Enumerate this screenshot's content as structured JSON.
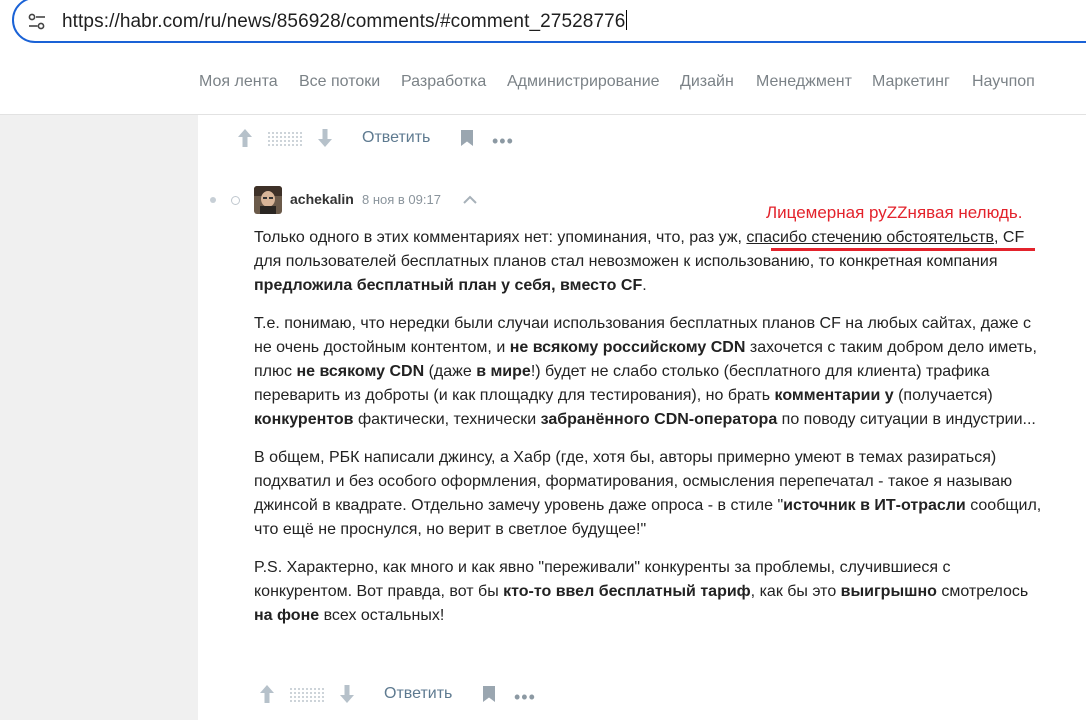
{
  "browser": {
    "url": "https://habr.com/ru/news/856928/comments/#comment_27528776"
  },
  "nav": {
    "items": [
      "Моя лента",
      "Все потоки",
      "Разработка",
      "Администрирование",
      "Дизайн",
      "Менеджмент",
      "Маркетинг",
      "Научпоп"
    ]
  },
  "actions": {
    "reply_label": "Ответить"
  },
  "comment": {
    "author": "achekalin",
    "timestamp": "8 ноя в 09:17",
    "p1": {
      "t1": "Только одного в этих комментариях нет: упоминания, что, раз уж, ",
      "u1": "спасибо стечению обстоятельств",
      "t2": ", CF для пользователей бесплатных планов стал невозможен к использованию, то конкретная компания ",
      "b1": "предложила бесплатный план у себя, вместо CF",
      "t3": "."
    },
    "p2": {
      "t1": "Т.е. понимаю, что нередки были случаи использования бесплатных планов CF на любых сайтах, даже с не очень достойным контентом, и ",
      "b1": "не всякому российскому CDN",
      "t2": " захочется с таким добром дело иметь, плюс ",
      "b2": "не всякому CDN",
      "t3": " (даже ",
      "b3": "в мире",
      "t4": "!) будет не слабо столько (бесплатного для клиента) трафика переварить из доброты (и как площадку для тестирования), но брать ",
      "b4": "комментарии у",
      "t5": " (получается) ",
      "b5": "конкурентов",
      "t6": " фактически, технически ",
      "b6": "забранённого CDN-оператора",
      "t7": " по поводу ситуации в индустрии..."
    },
    "p3": {
      "t1": "В общем, РБК написали джинсу, а Хабр (где, хотя бы, авторы примерно умеют в темах разираться) подхватил и без особого оформления, форматирования, осмысления перепечатал - такое я называю джинсой в квадрате. Отдельно замечу уровень даже опроса - в стиле \"",
      "b1": "источник в ИТ-отрасли",
      "t2": " сообщил, что ещё не проснулся, но верит в светлое будущее!\""
    },
    "p4": {
      "t1": "P.S. Характерно, как много и как явно \"переживали\" конкуренты за проблемы, случившиеся с конкурентом. Вот правда, вот бы ",
      "b1": "кто-то ввел бесплатный тариф",
      "t2": ", как бы это ",
      "b2": "выигрышно",
      "t3": " смотрелось ",
      "b3": "на фоне",
      "t4": " всех остальных!"
    }
  },
  "annotation": {
    "text": "Лицемерная руZZнявая нелюдь.",
    "color": "#e3232c"
  },
  "colors": {
    "url_focus": "#1a62d6",
    "link": "#5e7a90",
    "nav": "#7b8287"
  }
}
